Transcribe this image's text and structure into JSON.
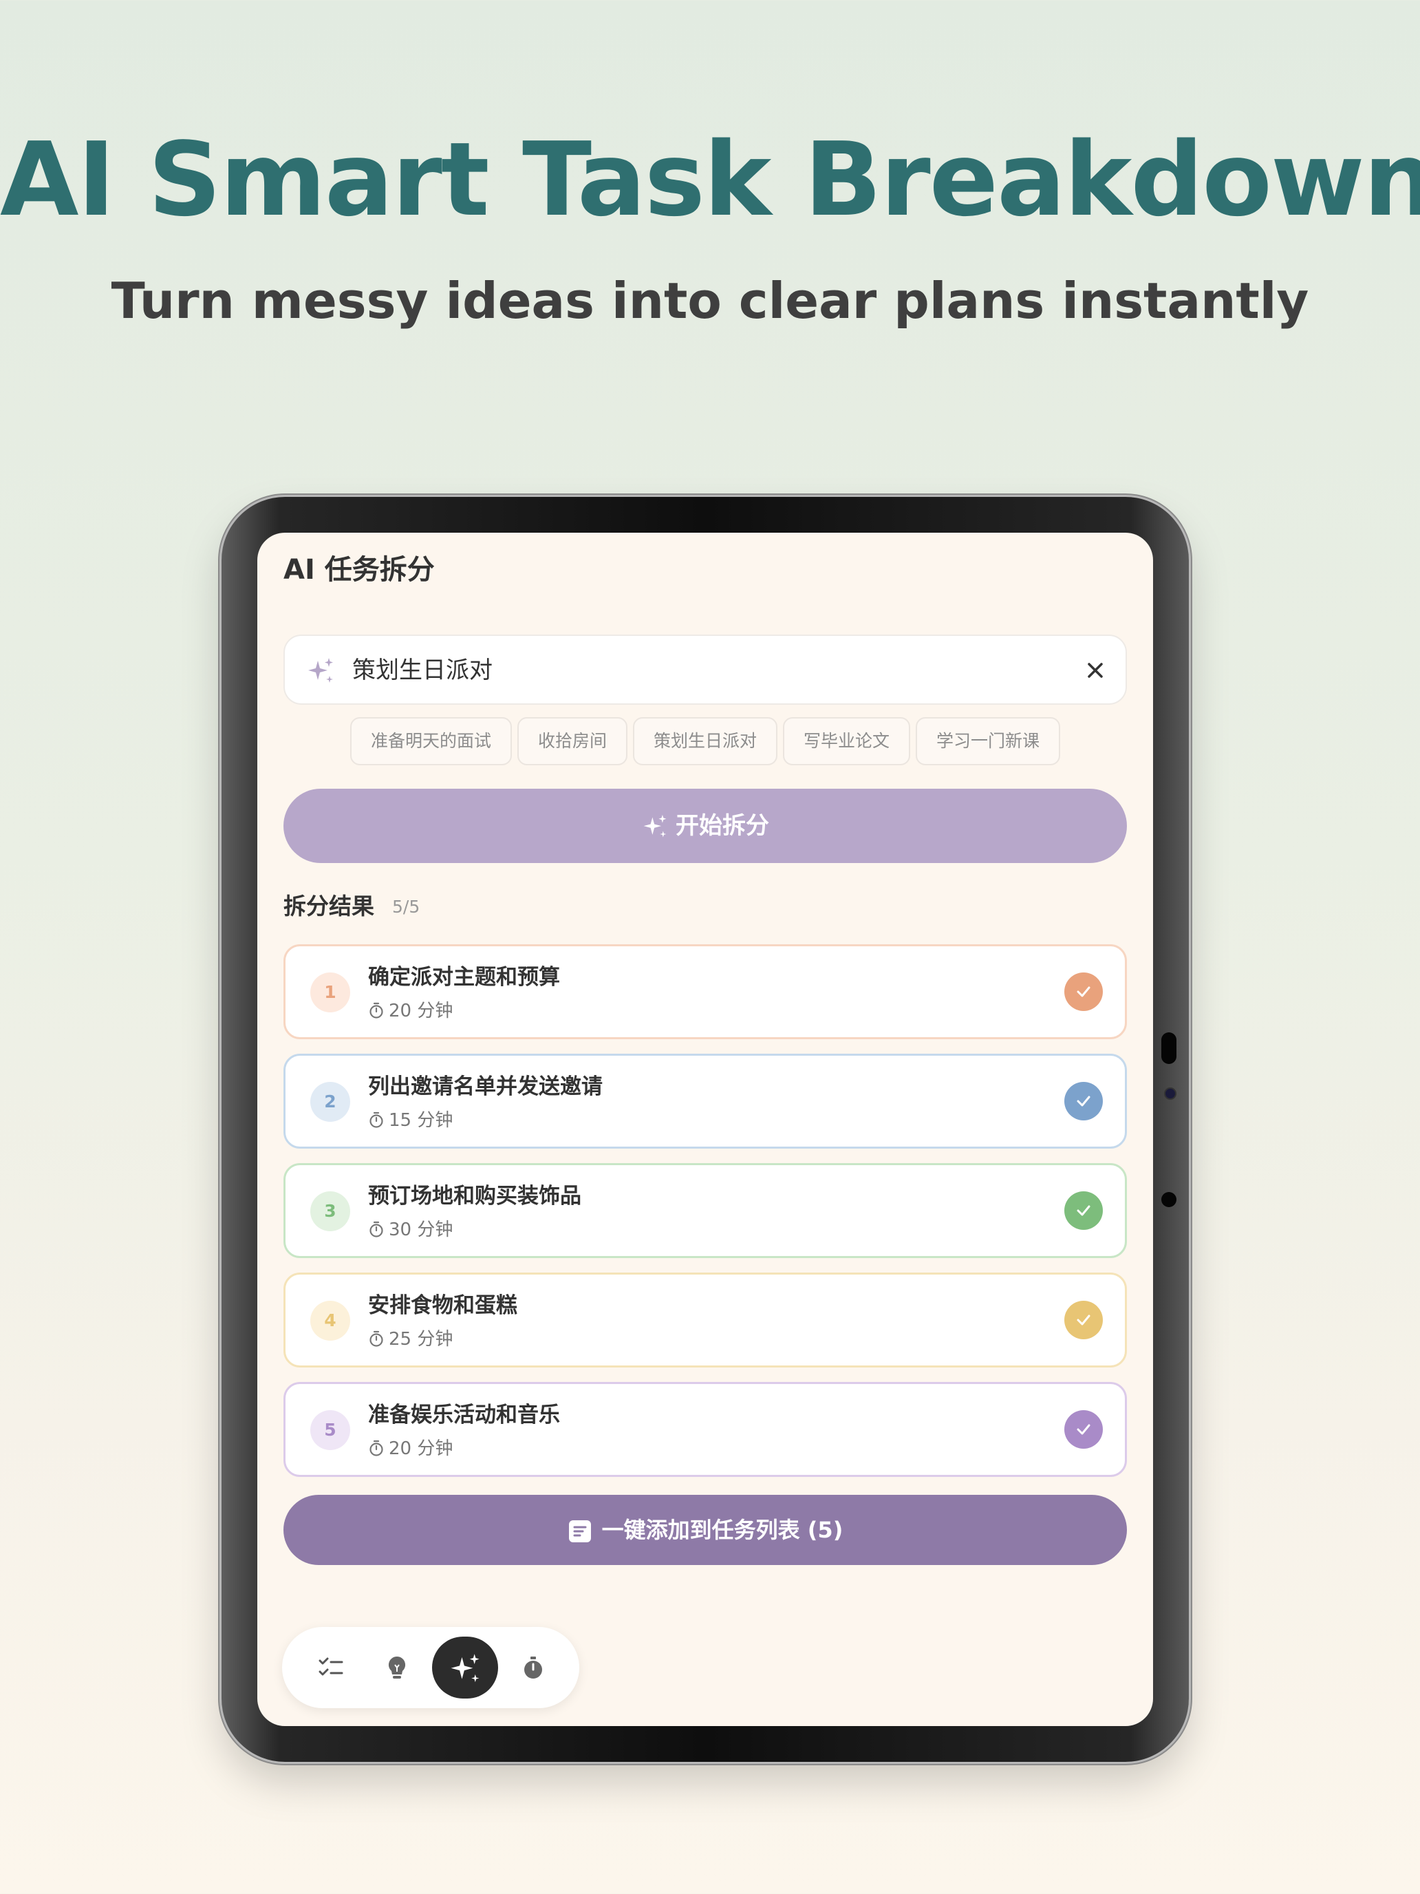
{
  "marketing": {
    "headline": "AI Smart Task Breakdown",
    "subheadline": "Turn messy ideas into clear plans instantly"
  },
  "app": {
    "title": "AI 任务拆分",
    "search": {
      "value": "策划生日派对",
      "icon": "sparkle-icon",
      "clear_icon": "close-icon"
    },
    "suggestions": [
      "准备明天的面试",
      "收拾房间",
      "策划生日派对",
      "写毕业论文",
      "学习一门新课"
    ],
    "start_button": "开始拆分",
    "results": {
      "title": "拆分结果",
      "count": "5/5",
      "tasks": [
        {
          "num": "1",
          "title": "确定派对主题和预算",
          "duration": "20 分钟",
          "color": "#e9a27c",
          "tint": "#fde9de",
          "border": "#f7d6c2"
        },
        {
          "num": "2",
          "title": "列出邀请名单并发送邀请",
          "duration": "15 分钟",
          "color": "#7ca2cc",
          "tint": "#e1ebf5",
          "border": "#c5d9ec"
        },
        {
          "num": "3",
          "title": "预订场地和购买装饰品",
          "duration": "30 分钟",
          "color": "#7dbd7c",
          "tint": "#e3f2e1",
          "border": "#c8e6c6"
        },
        {
          "num": "4",
          "title": "安排食物和蛋糕",
          "duration": "25 分钟",
          "color": "#e8c574",
          "tint": "#fcf1da",
          "border": "#f5e3b8"
        },
        {
          "num": "5",
          "title": "准备娱乐活动和音乐",
          "duration": "20 分钟",
          "color": "#a98bc8",
          "tint": "#efe6f6",
          "border": "#dccbea"
        }
      ]
    },
    "add_button": "一键添加到任务列表 (5)",
    "nav": [
      {
        "icon": "checklist-icon",
        "active": false
      },
      {
        "icon": "lightbulb-icon",
        "active": false
      },
      {
        "icon": "sparkle-icon",
        "active": true
      },
      {
        "icon": "timer-icon",
        "active": false
      }
    ]
  }
}
